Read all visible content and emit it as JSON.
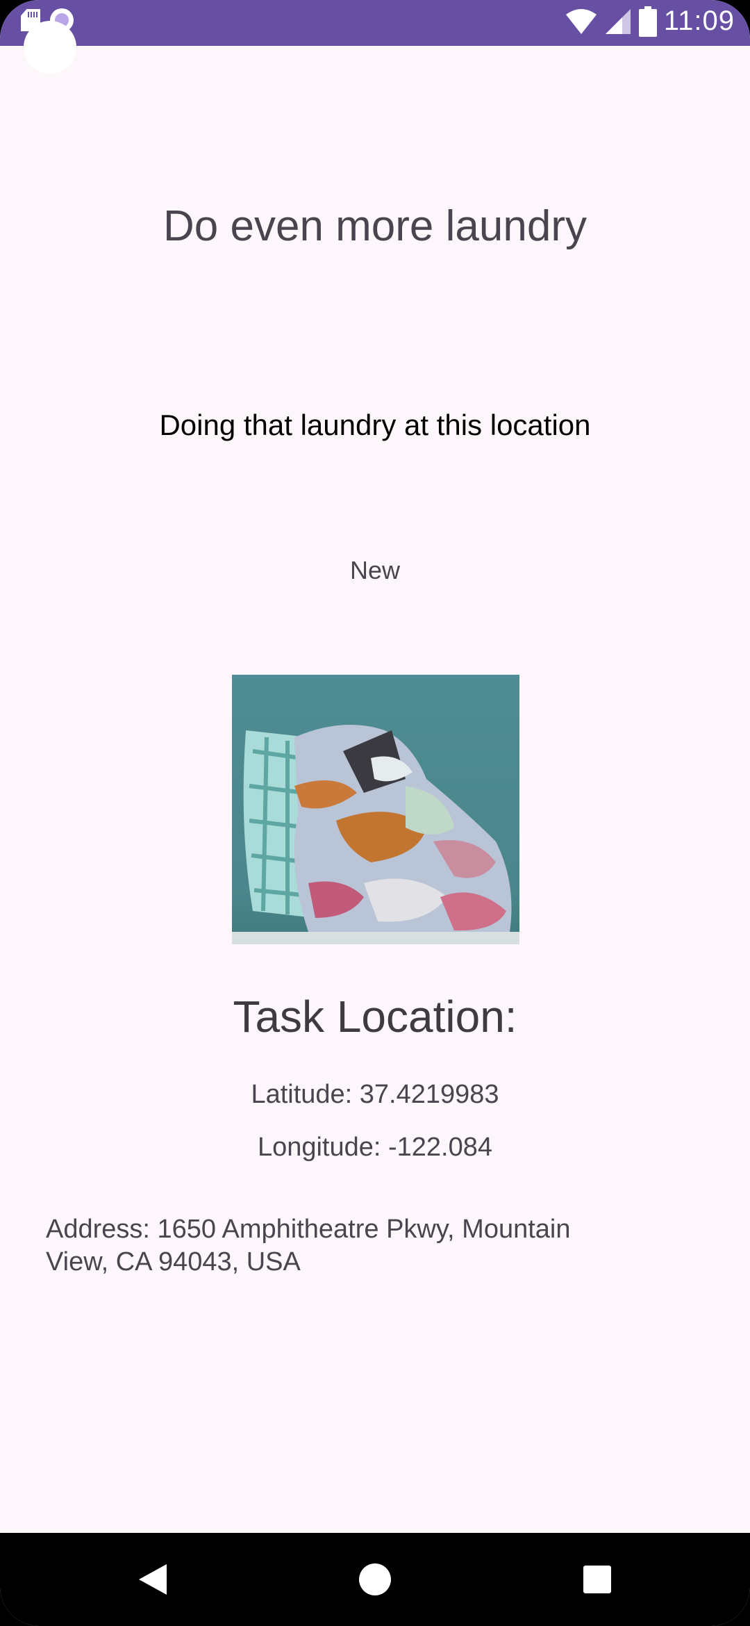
{
  "status_bar": {
    "time": "11:09",
    "icons": [
      "sd-card-icon",
      "screen-record-icon",
      "wifi-icon",
      "signal-icon",
      "battery-icon"
    ]
  },
  "task": {
    "title": "Do even more laundry",
    "description": "Doing that laundry at this location",
    "status": "New",
    "image_subject": "laundry basket with clothes"
  },
  "location": {
    "heading": "Task Location:",
    "latitude": "Latitude: 37.4219983",
    "longitude": "Longitude: -122.084",
    "address": "Address: 1650 Amphitheatre Pkwy, Mountain View, CA 94043, USA"
  },
  "nav": {
    "back": "back-icon",
    "home": "home-icon",
    "recents": "recents-icon"
  },
  "colors": {
    "status_bar": "#6750a4",
    "background": "#fdf7fb",
    "text_primary": "#49454f"
  }
}
